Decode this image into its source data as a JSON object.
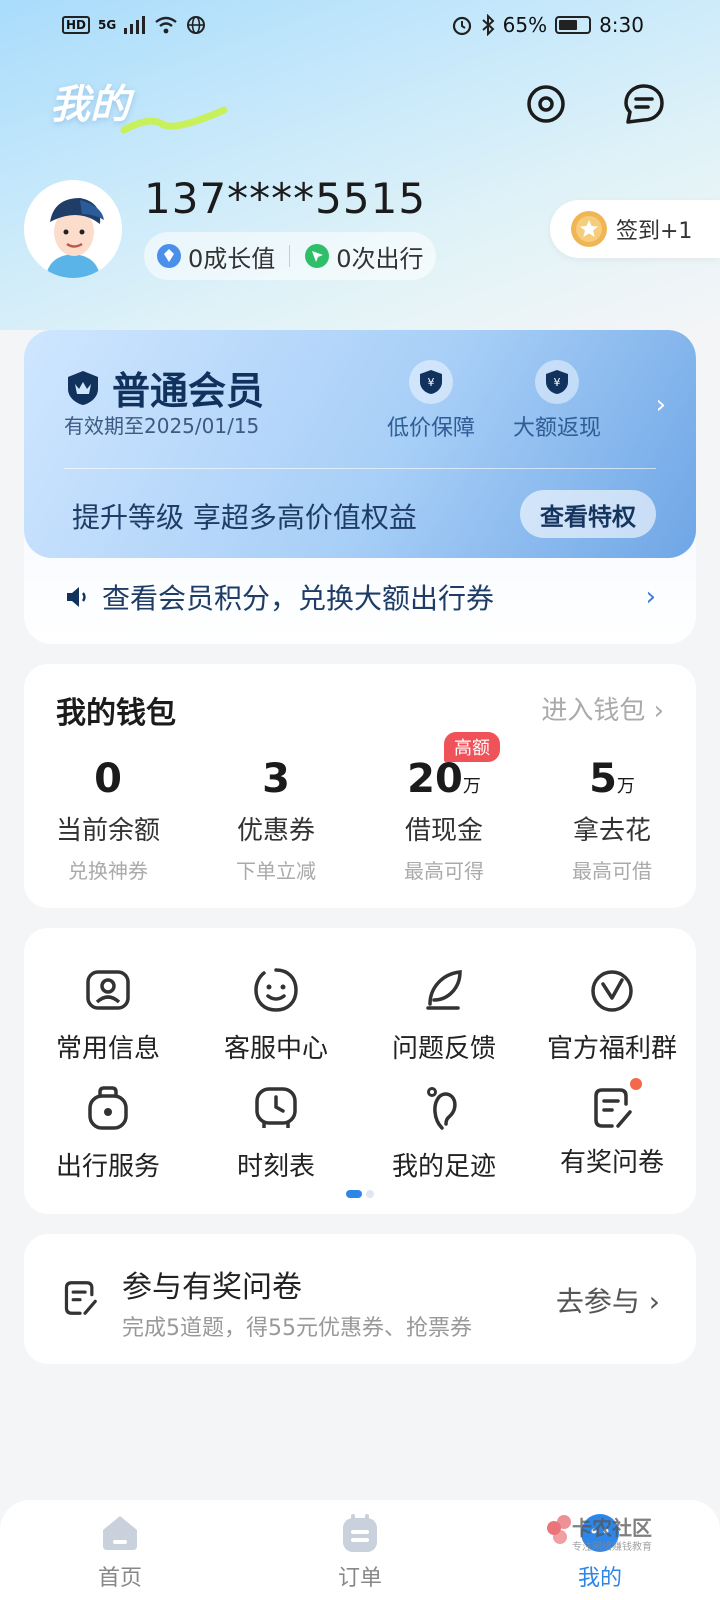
{
  "status_bar": {
    "network": "HD",
    "signal": "5G",
    "battery_pct": "65%",
    "time": "8:30"
  },
  "header": {
    "title": "我的"
  },
  "profile": {
    "phone": "137****5515",
    "growth": "0成长值",
    "trips": "0次出行",
    "checkin": "签到+1"
  },
  "membership": {
    "tier": "普通会员",
    "expiry": "有效期至2025/01/15",
    "benefits": [
      {
        "label": "低价保障"
      },
      {
        "label": "大额返现"
      }
    ],
    "upgrade_text": "提升等级 享超多高价值权益",
    "privilege_button": "查看特权",
    "points_text": "查看会员积分，兑换大额出行券"
  },
  "wallet": {
    "title": "我的钱包",
    "enter_link": "进入钱包",
    "high_badge": "高额",
    "items": [
      {
        "value": "0",
        "unit": "",
        "label": "当前余额",
        "sub": "兑换神券"
      },
      {
        "value": "3",
        "unit": "",
        "label": "优惠券",
        "sub": "下单立减"
      },
      {
        "value": "20",
        "unit": "万",
        "label": "借现金",
        "sub": "最高可得"
      },
      {
        "value": "5",
        "unit": "万",
        "label": "拿去花",
        "sub": "最高可借"
      }
    ]
  },
  "services": {
    "items": [
      {
        "label": "常用信息",
        "icon": "id-card-icon"
      },
      {
        "label": "客服中心",
        "icon": "customer-service-icon"
      },
      {
        "label": "问题反馈",
        "icon": "feedback-icon"
      },
      {
        "label": "官方福利群",
        "icon": "welfare-group-icon"
      },
      {
        "label": "出行服务",
        "icon": "luggage-icon"
      },
      {
        "label": "时刻表",
        "icon": "timetable-icon"
      },
      {
        "label": "我的足迹",
        "icon": "footprint-icon"
      },
      {
        "label": "有奖问卷",
        "icon": "survey-icon"
      }
    ]
  },
  "survey": {
    "title": "参与有奖问卷",
    "desc": "完成5道题，得55元优惠券、抢票券",
    "button": "去参与"
  },
  "tabbar": {
    "items": [
      {
        "label": "首页"
      },
      {
        "label": "订单"
      },
      {
        "label": "我的"
      }
    ]
  },
  "watermark": {
    "text": "卡农社区",
    "sub": "专注网络赚钱教育"
  },
  "colors": {
    "accent": "#2e86e8",
    "badge_red": "#f0525a",
    "member_dark": "#12325e"
  }
}
